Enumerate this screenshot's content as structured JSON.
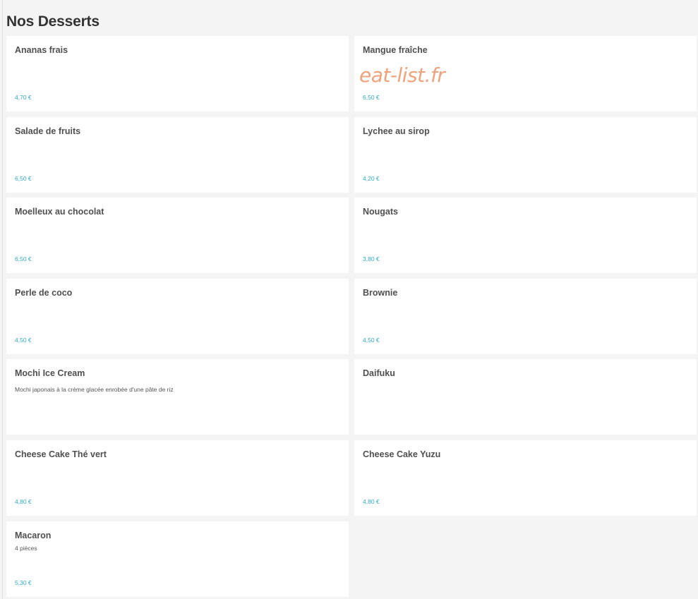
{
  "section": {
    "title": "Nos Desserts"
  },
  "watermark": "eat-list.fr",
  "colors": {
    "background": "#f4f4f4",
    "card": "#ffffff",
    "title": "#333333",
    "item_name": "#4f4f4f",
    "price": "#2fa9c8",
    "watermark": "#f0a27a"
  },
  "items": [
    {
      "name": "Ananas frais",
      "price": "4,70 €"
    },
    {
      "name": "Mangue fraîche",
      "price": "6,50 €"
    },
    {
      "name": "Salade de fruits",
      "price": "6,50 €"
    },
    {
      "name": "Lychee au sirop",
      "price": "4,20 €"
    },
    {
      "name": "Moelleux au chocolat",
      "price": "6,50 €"
    },
    {
      "name": "Nougats",
      "price": "3,80 €"
    },
    {
      "name": "Perle de coco",
      "price": "4,50 €"
    },
    {
      "name": "Brownie",
      "price": "4,50 €"
    },
    {
      "name": "Mochi Ice Cream",
      "description": "Mochi japonais à la crème glacée enrobée d'une pâte de riz"
    },
    {
      "name": "Daifuku"
    },
    {
      "name": "Cheese Cake Thé vert",
      "price": "4,80 €"
    },
    {
      "name": "Cheese Cake Yuzu",
      "price": "4,80 €"
    },
    {
      "name": "Macaron",
      "subtitle": "4 pièces",
      "price": "5,30 €"
    }
  ]
}
